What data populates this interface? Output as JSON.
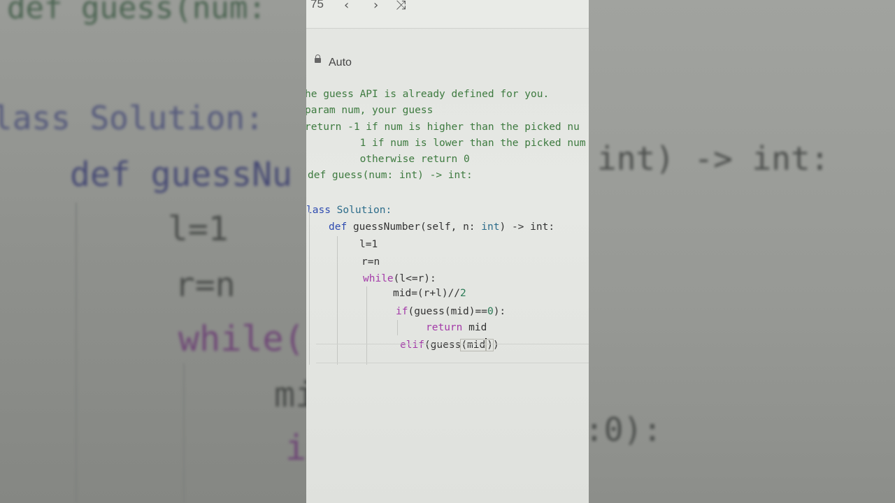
{
  "topbar": {
    "counter": "75",
    "prev_icon": "chevron-left-icon",
    "next_icon": "chevron-right-icon",
    "shuffle_icon": "shuffle-icon"
  },
  "language": {
    "label": "Auto",
    "icon": "lock-icon"
  },
  "code_lines": {
    "c1": "he guess API is already defined for you.",
    "c2": "param num, your guess",
    "c3": "return -1 if num is higher than the picked nu",
    "c4": "         1 if num is lower than the picked num",
    "c5": "         otherwise return 0",
    "c6": "def guess(num: int) -> int:",
    "l_class_kw": "lass",
    "l_class_name": "Solution:",
    "l_def_kw": "def",
    "l_def_rest": "guessNumber(self, n:",
    "l_def_int": "int",
    "l_def_arrow": ") -> int:",
    "l_l1": "l=1",
    "l_rn": "r=n",
    "l_while_kw": "while",
    "l_while_rest": "(l<=r):",
    "l_mid": "mid=(r+l)//",
    "l_mid_num": "2",
    "l_if_kw": "if",
    "l_if_rest": "(guess(mid)==",
    "l_if_num": "0",
    "l_if_end": "):",
    "l_return_kw": "return",
    "l_return_rest": " mid",
    "l_elif_kw": "elif",
    "l_elif_a": "(guess",
    "l_elif_b": "(mid",
    "l_elif_c": ")",
    "l_elif_d": ")"
  },
  "background": {
    "left_top": "def guess(num:",
    "left_class": "lass Solution:",
    "left_def": "def guessNu",
    "left_l": "l=1",
    "left_r": "r=n",
    "left_while": "while(",
    "left_mid": "mi",
    "left_if": "i",
    "right_sig": "int) -> int:",
    "right_zero": ":0):"
  },
  "colors": {
    "comment": "#3d7a3f",
    "keyword": "#2e4bb0",
    "control": "#a33aa8"
  }
}
